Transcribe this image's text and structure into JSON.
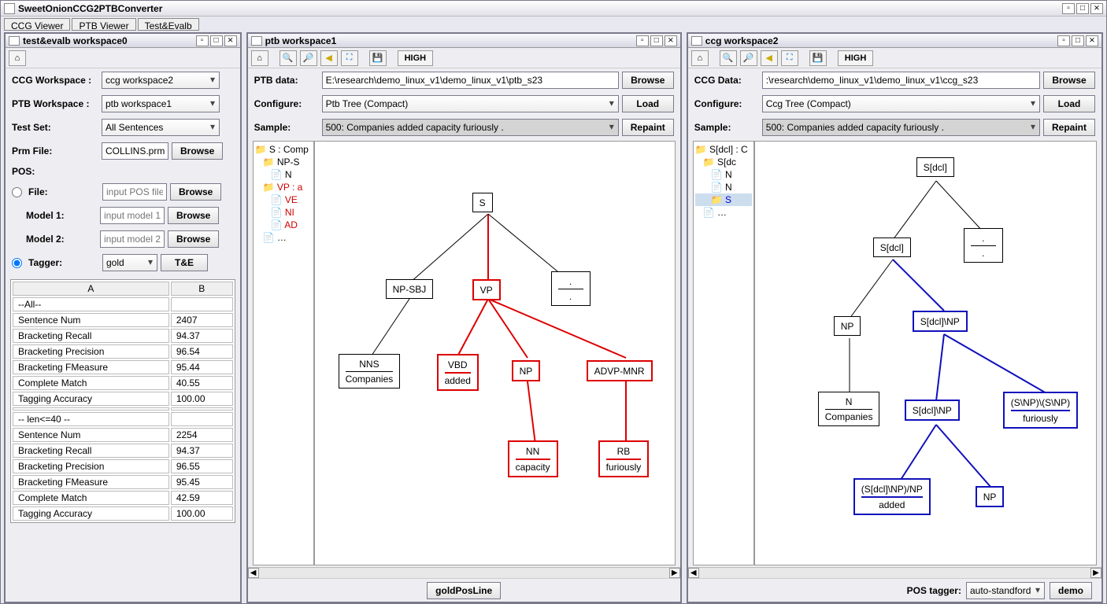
{
  "app": {
    "title": "SweetOnionCCG2PTBConverter"
  },
  "tabs": {
    "ccg": "CCG Viewer",
    "ptb": "PTB Viewer",
    "te": "Test&Evalb"
  },
  "left": {
    "title": "test&evalb workspace0",
    "ccgws_lbl": "CCG Workspace :",
    "ccgws": "ccg workspace2",
    "ptbws_lbl": "PTB Workspace :",
    "ptbws": "ptb workspace1",
    "testset_lbl": "Test Set:",
    "testset": "All Sentences",
    "prm_lbl": "Prm File:",
    "prm": "COLLINS.prm",
    "browse": "Browse",
    "pos_lbl": "POS:",
    "file_lbl": "File:",
    "file_ph": "input POS file",
    "m1_lbl": "Model 1:",
    "m1_ph": "input model 1",
    "m2_lbl": "Model 2:",
    "m2_ph": "input model 2",
    "tagger_lbl": "Tagger:",
    "tagger": "gold",
    "te_btn": "T&E",
    "table": {
      "hA": "A",
      "hB": "B",
      "rows": [
        [
          "--All--",
          ""
        ],
        [
          "Sentence Num",
          "2407"
        ],
        [
          "Bracketing Recall",
          "94.37"
        ],
        [
          "Bracketing Precision",
          "96.54"
        ],
        [
          "Bracketing FMeasure",
          "95.44"
        ],
        [
          "Complete Match",
          "40.55"
        ],
        [
          "Tagging Accuracy",
          "100.00"
        ],
        [
          "",
          ""
        ],
        [
          "-- len<=40 --",
          ""
        ],
        [
          "Sentence Num",
          "2254"
        ],
        [
          "Bracketing Recall",
          "94.37"
        ],
        [
          "Bracketing Precision",
          "96.55"
        ],
        [
          "Bracketing FMeasure",
          "95.45"
        ],
        [
          "Complete Match",
          "42.59"
        ],
        [
          "Tagging Accuracy",
          "100.00"
        ]
      ]
    }
  },
  "mid": {
    "title": "ptb workspace1",
    "high": "HIGH",
    "data_lbl": "PTB data:",
    "data": "E:\\research\\demo_linux_v1\\demo_linux_v1\\ptb_s23",
    "browse": "Browse",
    "conf_lbl": "Configure:",
    "conf": "Ptb Tree (Compact)",
    "load": "Load",
    "samp_lbl": "Sample:",
    "samp": "500: Companies added capacity furiously .",
    "repaint": "Repaint",
    "tree": [
      "S : Comp",
      "NP-S",
      "N",
      "VP : a",
      "VE",
      "NI",
      "AD",
      "…"
    ],
    "footer_btn": "goldPosLine",
    "nodes": {
      "S": "S",
      "NPSBJ": "NP-SBJ",
      "VP": "VP",
      "dot": ".",
      "dot2": ".",
      "NNS": "NNS",
      "Companies": "Companies",
      "VBD": "VBD",
      "added": "added",
      "NP": "NP",
      "ADVP": "ADVP-MNR",
      "NN": "NN",
      "capacity": "capacity",
      "RB": "RB",
      "furiously": "furiously"
    }
  },
  "right": {
    "title": "ccg workspace2",
    "high": "HIGH",
    "data_lbl": "CCG Data:",
    "data": ":\\research\\demo_linux_v1\\demo_linux_v1\\ccg_s23",
    "browse": "Browse",
    "conf_lbl": "Configure:",
    "conf": "Ccg Tree (Compact)",
    "load": "Load",
    "samp_lbl": "Sample:",
    "samp": "500: Companies added capacity furiously .",
    "repaint": "Repaint",
    "tree": [
      "S[dcl] : C",
      "S[dc",
      "N",
      "N",
      "S",
      "…"
    ],
    "footer_lbl": "POS tagger:",
    "footer_sel": "auto-standford",
    "footer_btn": "demo",
    "nodes": {
      "Sdcl": "S[dcl]",
      "dot": ".",
      "dot2": ".",
      "Sdcl2": "S[dcl]",
      "NP": "NP",
      "SdclNP": "S[dcl]\\NP",
      "N": "N",
      "Companies": "Companies",
      "SdclNP2": "S[dcl]\\NP",
      "SNPSNP": "(S\\NP)\\(S\\NP)",
      "furiously": "furiously",
      "SdclNPNP": "(S[dcl]\\NP)/NP",
      "added": "added",
      "NP2": "NP"
    }
  }
}
